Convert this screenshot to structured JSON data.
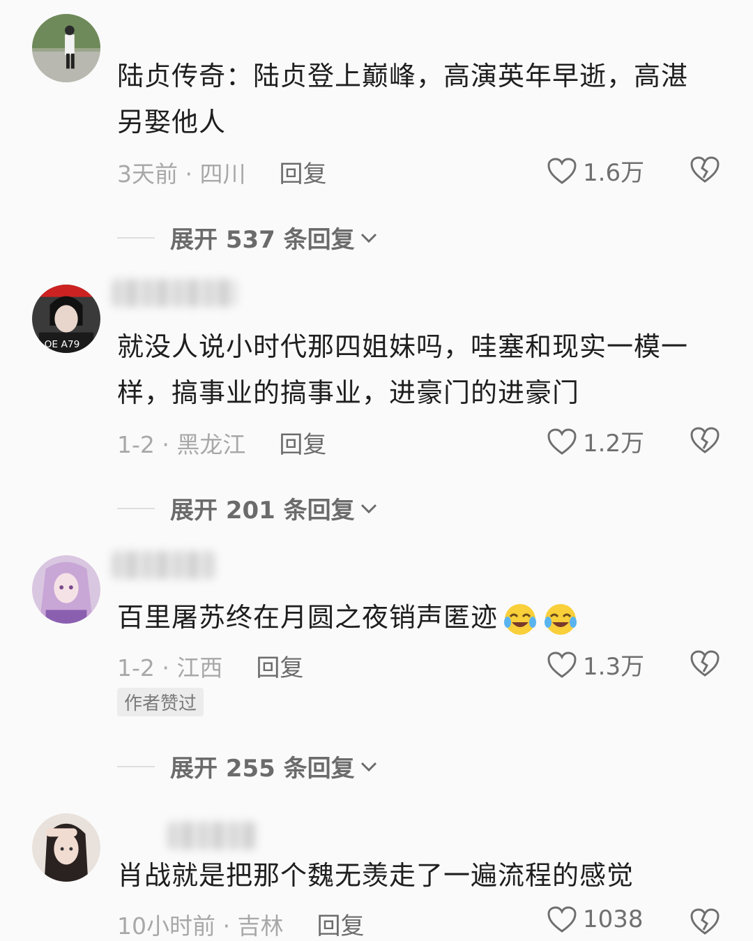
{
  "comments": [
    {
      "text": "陆贞传奇：陆贞登上巅峰，高演英年早逝，高湛另娶他人",
      "time": "3天前 · 四川",
      "reply_label": "回复",
      "likes": "1.6万",
      "expand_label": "展开 537 条回复"
    },
    {
      "text": "就没人说小时代那四姐妹吗，哇塞和现实一模一样，搞事业的搞事业，进豪门的进豪门",
      "time": "1-2 · 黑龙江",
      "reply_label": "回复",
      "likes": "1.2万",
      "expand_label": "展开 201 条回复"
    },
    {
      "text": "百里屠苏终在月圆之夜销声匿迹",
      "time": "1-2 · 江西",
      "reply_label": "回复",
      "likes": "1.3万",
      "badge": "作者赞过",
      "expand_label": "展开 255 条回复"
    },
    {
      "text": "肖战就是把那个魏无羡走了一遍流程的感觉",
      "time": "10小时前 · 吉林",
      "reply_label": "回复",
      "likes": "1038"
    }
  ],
  "icons": {
    "like": "heart-outline-icon",
    "dislike": "broken-heart-icon",
    "expand": "chevron-down-icon",
    "emoji": "crying-laughing-emoji"
  },
  "colors": {
    "background": "#fafafa",
    "text": "#1e1e1e",
    "meta": "#a8a8a8",
    "action": "#6b6b6b"
  }
}
